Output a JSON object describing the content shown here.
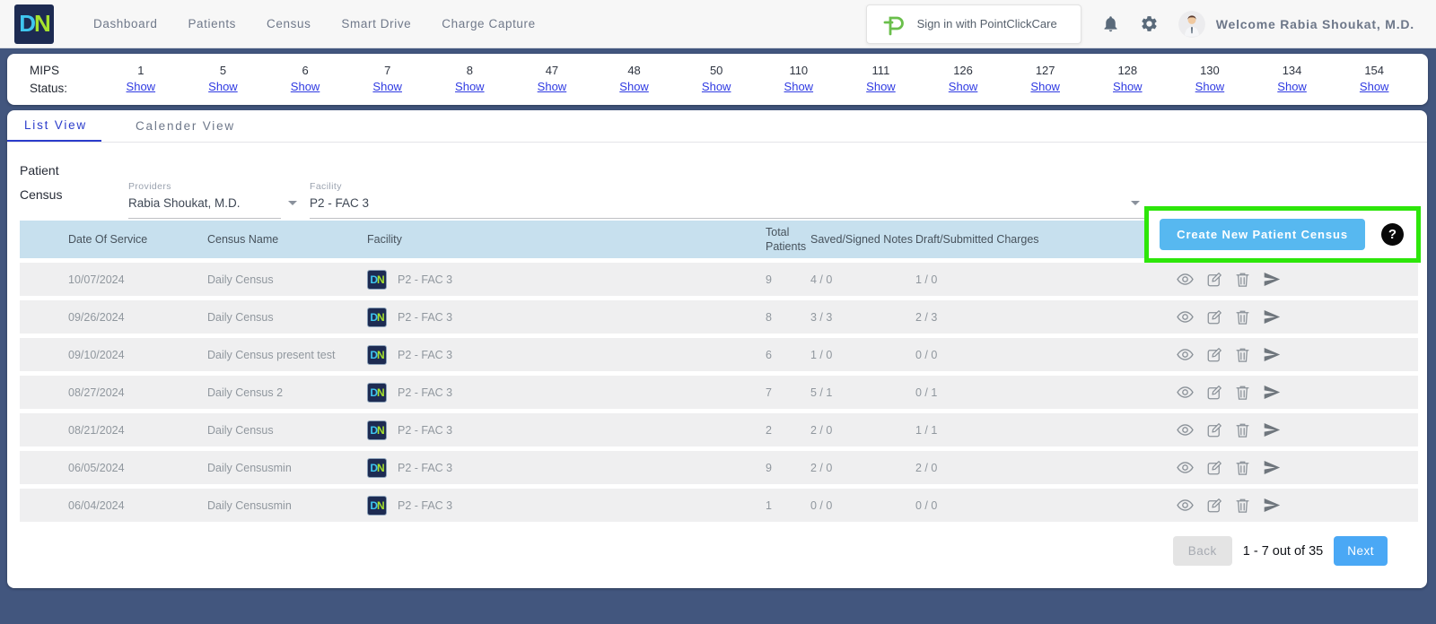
{
  "logo": {
    "d": "D",
    "n": "N"
  },
  "nav": {
    "items": [
      "Dashboard",
      "Patients",
      "Census",
      "Smart Drive",
      "Charge Capture"
    ],
    "signin_label": "Sign in with PointClickCare",
    "pcc_letter": "P",
    "welcome": "Welcome Rabia Shoukat, M.D."
  },
  "mips": {
    "label_line1": "MIPS",
    "label_line2": "Status:",
    "show_label": "Show",
    "codes": [
      "1",
      "5",
      "6",
      "7",
      "8",
      "47",
      "48",
      "50",
      "110",
      "111",
      "126",
      "127",
      "128",
      "130",
      "134",
      "154"
    ]
  },
  "tabs": {
    "list": "List View",
    "calendar": "Calender View"
  },
  "filters": {
    "section_line1": "Patient",
    "section_line2": "Census",
    "providers_label": "Providers",
    "providers_value": "Rabia Shoukat, M.D.",
    "facility_label": "Facility",
    "facility_value": "P2 - FAC 3",
    "create_button": "Create New Patient Census",
    "help_icon": "?"
  },
  "table": {
    "headers": {
      "date": "Date Of Service",
      "name": "Census Name",
      "facility": "Facility",
      "total_line1": "Total",
      "total_line2": "Patients",
      "notes": "Saved/Signed Notes",
      "charges": "Draft/Submitted Charges"
    },
    "rows": [
      {
        "status": "green",
        "date": "10/07/2024",
        "name": "Daily Census",
        "facility": "P2 - FAC 3",
        "total": "9",
        "notes": "4 / 0",
        "charges": "1 / 0"
      },
      {
        "status": "green",
        "date": "09/26/2024",
        "name": "Daily Census",
        "facility": "P2 - FAC 3",
        "total": "8",
        "notes": "3 / 3",
        "charges": "2 / 3"
      },
      {
        "status": "green",
        "date": "09/10/2024",
        "name": "Daily Census present test",
        "facility": "P2 - FAC 3",
        "total": "6",
        "notes": "1 / 0",
        "charges": "0 / 0"
      },
      {
        "status": "green",
        "date": "08/27/2024",
        "name": "Daily Census 2",
        "facility": "P2 - FAC 3",
        "total": "7",
        "notes": "5 / 1",
        "charges": "0 / 1"
      },
      {
        "status": "red",
        "date": "08/21/2024",
        "name": "Daily Census",
        "facility": "P2 - FAC 3",
        "total": "2",
        "notes": "2 / 0",
        "charges": "1 / 1"
      },
      {
        "status": "green",
        "date": "06/05/2024",
        "name": "Daily Censusmin",
        "facility": "P2 - FAC 3",
        "total": "9",
        "notes": "2 / 0",
        "charges": "2 / 0"
      },
      {
        "status": "green",
        "date": "06/04/2024",
        "name": "Daily Censusmin",
        "facility": "P2 - FAC 3",
        "total": "1",
        "notes": "0 / 0",
        "charges": "0 / 0"
      }
    ]
  },
  "pagination": {
    "back": "Back",
    "range": "1 - 7 out of 35",
    "next": "Next"
  },
  "colors": {
    "navy_background": "#42567e",
    "accent_blue": "#57b8f0",
    "link_blue": "#2f3ae2",
    "active_tab_blue": "#2b3ccb",
    "table_header_blue": "#c7e0ee",
    "highlight_green": "#2de60a",
    "status_green": "#1fc11f",
    "status_red": "#f31414",
    "pcc_green": "#6abf4b"
  }
}
